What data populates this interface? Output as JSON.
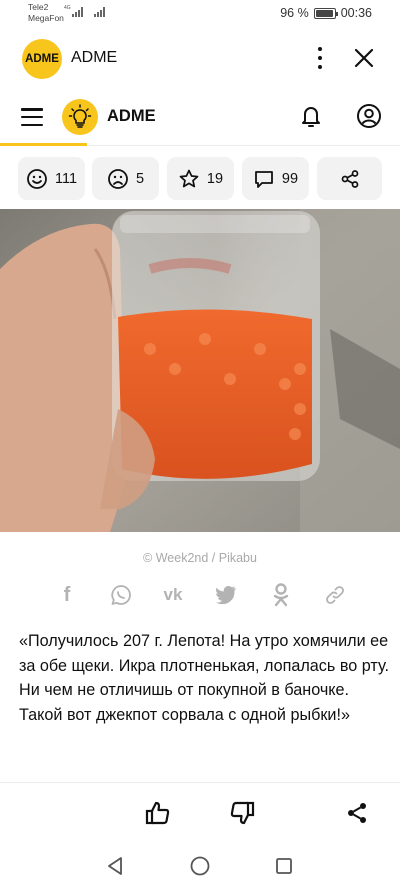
{
  "status_bar": {
    "carrier_1": "Tele2",
    "carrier_2": "MegaFon",
    "network_tag": "4G",
    "battery_text": "96 %",
    "battery_level": 0.96,
    "time": "00:36"
  },
  "app_header": {
    "logo_text": "ADME",
    "title": "ADME",
    "menu_icon": "more-vert-icon",
    "close_icon": "close-icon"
  },
  "site_header": {
    "menu_icon": "hamburger-icon",
    "logo_icon": "lightbulb-icon",
    "title": "ADME",
    "bell_icon": "bell-icon",
    "user_icon": "user-icon"
  },
  "reactions": [
    {
      "icon": "smile-icon",
      "count": "111"
    },
    {
      "icon": "sad-icon",
      "count": "5"
    },
    {
      "icon": "star-icon",
      "count": "19"
    },
    {
      "icon": "comment-icon",
      "count": "99"
    },
    {
      "icon": "share-icon",
      "count": ""
    }
  ],
  "article": {
    "caption": "© Week2nd / Pikabu",
    "quote": "«Получилось 207 г. Лепота! На утро хомячили ее за обе щеки. Икра плотненькая, лопалась во рту. Ни чем не отличишь от покупной в баночке. Такой вот джекпот сорвала с одной рыбки!»"
  },
  "share_links": [
    {
      "icon": "facebook-icon",
      "glyph": "f"
    },
    {
      "icon": "whatsapp-icon",
      "glyph": ""
    },
    {
      "icon": "vk-icon",
      "glyph": "vk"
    },
    {
      "icon": "twitter-icon",
      "glyph": ""
    },
    {
      "icon": "odnoklassniki-icon",
      "glyph": ""
    },
    {
      "icon": "link-icon",
      "glyph": ""
    }
  ],
  "bottom_toolbar": {
    "like_icon": "thumbs-up-icon",
    "dislike_icon": "thumbs-down-icon",
    "share_icon": "share-icon"
  },
  "nav_bar": {
    "back_icon": "back-triangle-icon",
    "home_icon": "home-circle-icon",
    "recents_icon": "recents-square-icon"
  },
  "colors": {
    "brand_yellow": "#f8c51c",
    "reaction_bg": "#f2f2f2",
    "share_icon_grey": "#b3b3b3"
  }
}
